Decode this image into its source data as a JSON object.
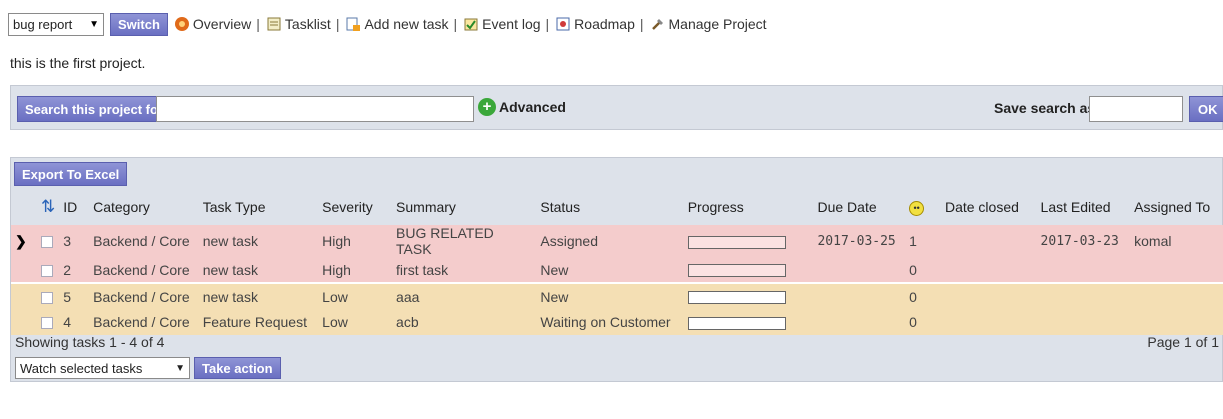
{
  "toolbar": {
    "project_select": "bug report",
    "switch_label": "Switch",
    "links": [
      {
        "label": "Overview",
        "icon": "overview-icon"
      },
      {
        "label": "Tasklist",
        "icon": "tasklist-icon"
      },
      {
        "label": "Add new task",
        "icon": "add-task-icon"
      },
      {
        "label": "Event log",
        "icon": "event-log-icon"
      },
      {
        "label": "Roadmap",
        "icon": "roadmap-icon"
      },
      {
        "label": "Manage Project",
        "icon": "manage-project-icon"
      }
    ]
  },
  "project_description": "this is the first project.",
  "search": {
    "button_label": "Search this project for",
    "query": "",
    "advanced_label": "Advanced",
    "save_search_label": "Save search as",
    "save_name": "",
    "ok_label": "OK"
  },
  "tasks": {
    "export_label": "Export To Excel",
    "columns": [
      "ID",
      "Category",
      "Task Type",
      "Severity",
      "Summary",
      "Status",
      "Progress",
      "Due Date",
      "",
      "Date closed",
      "Last Edited",
      "Assigned To"
    ],
    "rows": [
      {
        "id": "3",
        "category": "Backend / Core",
        "task_type": "new task",
        "severity": "High",
        "summary": "BUG RELATED TASK",
        "status": "Assigned",
        "progress": 0,
        "due_date": "2017-03-25",
        "votes": "1",
        "date_closed": "",
        "last_edited": "2017-03-23",
        "assigned_to": "komal"
      },
      {
        "id": "2",
        "category": "Backend / Core",
        "task_type": "new task",
        "severity": "High",
        "summary": "first task",
        "status": "New",
        "progress": 0,
        "due_date": "",
        "votes": "0",
        "date_closed": "",
        "last_edited": "",
        "assigned_to": ""
      },
      {
        "id": "5",
        "category": "Backend / Core",
        "task_type": "new task",
        "severity": "Low",
        "summary": "aaa",
        "status": "New",
        "progress": 0,
        "due_date": "",
        "votes": "0",
        "date_closed": "",
        "last_edited": "",
        "assigned_to": ""
      },
      {
        "id": "4",
        "category": "Backend / Core",
        "task_type": "Feature Request",
        "severity": "Low",
        "summary": "acb",
        "status": "Waiting on Customer",
        "progress": 0,
        "due_date": "",
        "votes": "0",
        "date_closed": "",
        "last_edited": "",
        "assigned_to": ""
      }
    ],
    "showing": "Showing tasks 1 - 4 of 4",
    "page": "Page 1 of 1"
  },
  "actions": {
    "selected": "Watch selected tasks",
    "take_action_label": "Take action"
  },
  "colors": {
    "high_row": "#f4cccc",
    "low_row": "#f4dfb4",
    "button": "#7a7fcb",
    "panel": "#dde2ea"
  }
}
